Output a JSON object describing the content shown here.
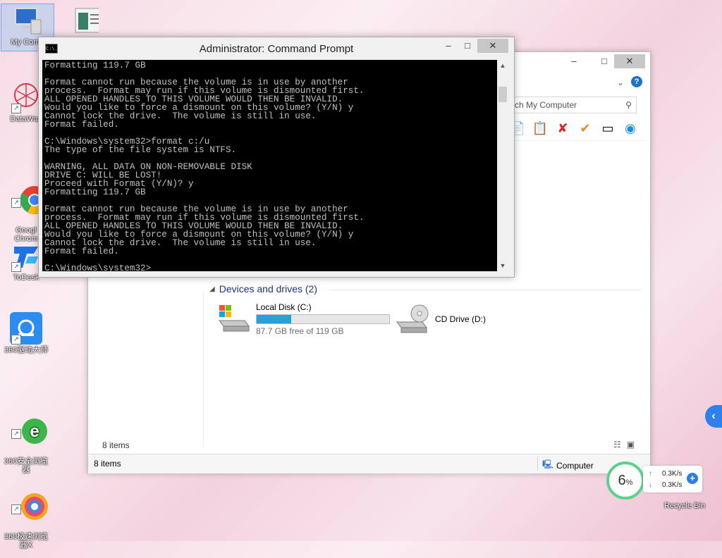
{
  "desktop": {
    "icons": [
      {
        "label": "My Comp",
        "icon": "computer-icon"
      },
      {
        "label": "",
        "icon": "window-app-icon"
      },
      {
        "label": "DataWag",
        "icon": "datawag-icon"
      },
      {
        "label": "Googl\nChrom",
        "icon": "chrome-icon"
      },
      {
        "label": "ToDesk",
        "icon": "todesk-icon"
      },
      {
        "label": "360驱动大师",
        "icon": "driver-icon"
      },
      {
        "label": "360安全浏览\n器",
        "icon": "ie-browser-icon"
      },
      {
        "label": "360极速浏览\n器X",
        "icon": "speed-browser-icon"
      }
    ],
    "recycle_bin": "Recycle Bin"
  },
  "cmd": {
    "title": "Administrator:  Command Prompt",
    "icon_text": "C:\\.",
    "controls": {
      "minimize": "–",
      "maximize": "□",
      "close": "✕"
    },
    "lines": [
      "Formatting 119.7 GB",
      "",
      "Format cannot run because the volume is in use by another",
      "process.  Format may run if this volume is dismounted first.",
      "ALL OPENED HANDLES TO THIS VOLUME WOULD THEN BE INVALID.",
      "Would you like to force a dismount on this volume? (Y/N) y",
      "Cannot lock the drive.  The volume is still in use.",
      "Format failed.",
      "",
      "C:\\Windows\\system32>format c:/u",
      "The type of the file system is NTFS.",
      "",
      "WARNING, ALL DATA ON NON-REMOVABLE DISK",
      "DRIVE C: WILL BE LOST!",
      "Proceed with Format (Y/N)? y",
      "Formatting 119.7 GB",
      "",
      "Format cannot run because the volume is in use by another",
      "process.  Format may run if this volume is dismounted first.",
      "ALL OPENED HANDLES TO THIS VOLUME WOULD THEN BE INVALID.",
      "Would you like to force a dismount on this volume? (Y/N) y",
      "Cannot lock the drive.  The volume is still in use.",
      "Format failed.",
      "",
      "C:\\Windows\\system32>"
    ]
  },
  "explorer": {
    "controls": {
      "minimize": "–",
      "maximize": "□",
      "close": "✕"
    },
    "search_placeholder": "rch My Computer",
    "help": "?",
    "group_title": "Devices and drives (2)",
    "drives": [
      {
        "name": "Local Disk (C:)",
        "free_text": "87.7 GB free of 119 GB",
        "used_fraction": 0.263
      },
      {
        "name": "CD Drive (D:)"
      }
    ],
    "items_count_inner": "8 items",
    "status_items": "8 items",
    "status_location": "Computer"
  },
  "net_widget": {
    "percent": "6",
    "percent_unit": "%",
    "up_speed": "0.3K/s",
    "down_speed": "0.3K/s"
  },
  "colors": {
    "drive_bar": "#26a0da",
    "group_header": "#1e3287",
    "accent_ring": "#5dd18b"
  }
}
